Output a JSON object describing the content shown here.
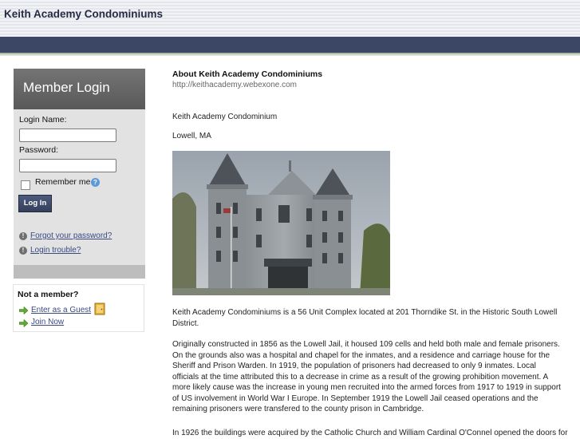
{
  "header": {
    "site_title": "Keith Academy Condominiums"
  },
  "login": {
    "title": "Member Login",
    "login_name_label": "Login Name:",
    "login_name_value": "",
    "password_label": "Password:",
    "password_value": "",
    "remember_label": "Remember me",
    "remember_checked": false,
    "login_button": "Log In",
    "forgot_password": "Forgot your password?",
    "login_trouble": "Login trouble?"
  },
  "member": {
    "title": "Not a member?",
    "guest_link": "Enter as a Guest",
    "join_link": "Join Now"
  },
  "main": {
    "title": "About Keith Academy Condominiums",
    "url": "http://keithacademy.webexone.com",
    "name": "Keith Academy Condominium",
    "location": "Lowell, MA",
    "paragraphs": [
      "Keith Academy Condominiums is a 56 Unit Complex located at 201 Thorndike St. in the Historic South Lowell District.",
      "Originally constructed in 1856 as the Lowell Jail, it housed 109 cells and held both male and female prisoners.  On the grounds also was a hospital and chapel for the inmates, and a residence and carriage house for the Sheriff and Prison Warden.  In 1919, the population of prisoners had decreased to only 9 inmates.  Local officials at the time attributed this to a decrease in crime as a result of the growing prohibition movement.  A more likely cause was the increase in young men recruited into the armed forces from 1917 to 1919 in support of US involvement in World War I Europe.  In September 1919 the Lowell Jail ceased operations and the remaining prisoners were transfered to the county prison in Cambridge.",
      "In 1926 the buildings were acquired by the Catholic Church and William Cardinal O'Connel opened the doors for"
    ]
  },
  "colors": {
    "nav_bar": "#3c4766",
    "login_header": "#5f5f5f",
    "login_panel": "#e2e2e2",
    "link": "#3a4a82"
  },
  "icons": {
    "help": "question-circle-icon",
    "info": "info-circle-icon",
    "arrow": "green-arrow-right-icon",
    "guest": "guest-door-icon"
  }
}
